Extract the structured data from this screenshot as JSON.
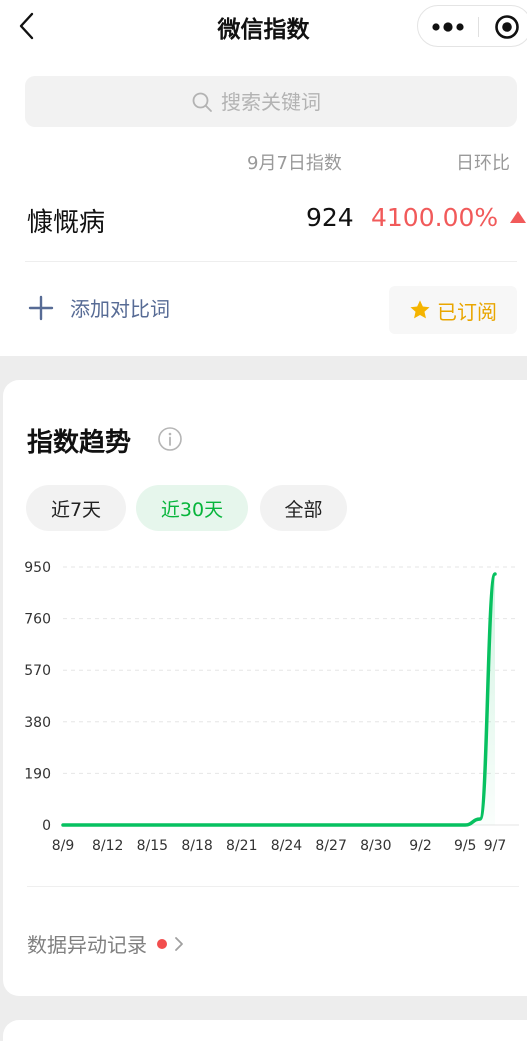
{
  "nav": {
    "title": "微信指数"
  },
  "search": {
    "placeholder": "搜索关键词"
  },
  "table_header": {
    "date_label": "9月7日指数",
    "change_label": "日环比"
  },
  "keyword": {
    "name": "慷慨病",
    "value": "924",
    "change": "4100.00%",
    "direction": "up"
  },
  "actions": {
    "add_compare": "添加对比词",
    "subscribe": "已订阅"
  },
  "trend": {
    "title": "指数趋势",
    "ranges": [
      "近7天",
      "近30天",
      "全部"
    ],
    "active_range": "近30天",
    "anomaly_link": "数据异动记录"
  },
  "colors": {
    "accent_green": "#07c160",
    "change_red": "#f15a5a",
    "link_blue": "#576b95",
    "star_gold": "#f5b400"
  },
  "chart_data": {
    "type": "line",
    "x": [
      "8/9",
      "8/10",
      "8/11",
      "8/12",
      "8/13",
      "8/14",
      "8/15",
      "8/16",
      "8/17",
      "8/18",
      "8/19",
      "8/20",
      "8/21",
      "8/22",
      "8/23",
      "8/24",
      "8/25",
      "8/26",
      "8/27",
      "8/28",
      "8/29",
      "8/30",
      "8/31",
      "9/1",
      "9/2",
      "9/3",
      "9/4",
      "9/5",
      "9/6",
      "9/7"
    ],
    "xticks": [
      "8/9",
      "8/12",
      "8/15",
      "8/18",
      "8/21",
      "8/24",
      "8/27",
      "8/30",
      "9/2",
      "9/5",
      "9/7"
    ],
    "values": [
      0,
      0,
      0,
      0,
      0,
      0,
      0,
      0,
      0,
      0,
      0,
      0,
      0,
      0,
      0,
      0,
      0,
      0,
      0,
      0,
      0,
      0,
      0,
      0,
      0,
      0,
      0,
      0,
      22,
      924
    ],
    "yticks": [
      0,
      190,
      380,
      570,
      760,
      950
    ],
    "ylim": [
      0,
      950
    ],
    "grid": true,
    "series": [
      {
        "values_ref": "values"
      }
    ]
  }
}
